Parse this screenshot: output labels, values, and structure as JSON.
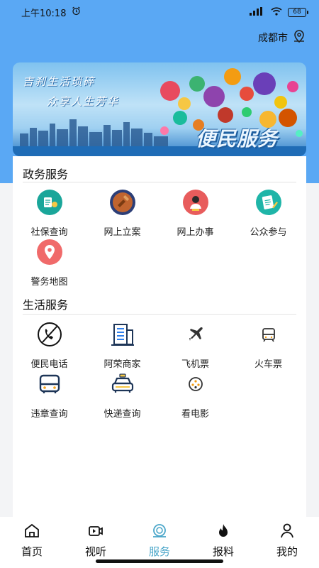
{
  "status_bar": {
    "time": "上午10:18",
    "network": "4G",
    "battery": "68"
  },
  "location": {
    "city": "成都市"
  },
  "banner": {
    "slogan_line1": "吉刹生活琐碎",
    "slogan_line2": "众享人生芳华",
    "title": "便民服务"
  },
  "gov_section": {
    "title": "政务服务",
    "items": [
      {
        "label": "社保查询",
        "icon": "social-security-icon"
      },
      {
        "label": "网上立案",
        "icon": "online-filing-icon"
      },
      {
        "label": "网上办事",
        "icon": "online-affairs-icon"
      },
      {
        "label": "公众参与",
        "icon": "public-participation-icon"
      },
      {
        "label": "警务地图",
        "icon": "police-map-icon"
      }
    ]
  },
  "life_section": {
    "title": "生活服务",
    "items": [
      {
        "label": "便民电话",
        "icon": "phone-icon"
      },
      {
        "label": "阿荣商家",
        "icon": "merchant-building-icon"
      },
      {
        "label": "飞机票",
        "icon": "airplane-icon"
      },
      {
        "label": "火车票",
        "icon": "train-icon"
      },
      {
        "label": "违章查询",
        "icon": "bus-icon"
      },
      {
        "label": "快递查询",
        "icon": "taxi-icon"
      },
      {
        "label": "看电影",
        "icon": "film-reel-icon"
      }
    ]
  },
  "bottom_nav": {
    "items": [
      {
        "label": "首页",
        "icon": "home-icon"
      },
      {
        "label": "视听",
        "icon": "video-icon"
      },
      {
        "label": "服务",
        "icon": "service-icon",
        "active": true
      },
      {
        "label": "报料",
        "icon": "fire-icon"
      },
      {
        "label": "我的",
        "icon": "user-icon"
      }
    ]
  },
  "colors": {
    "header_blue": "#5aa8f4",
    "active_tab": "#4aa6c9"
  }
}
